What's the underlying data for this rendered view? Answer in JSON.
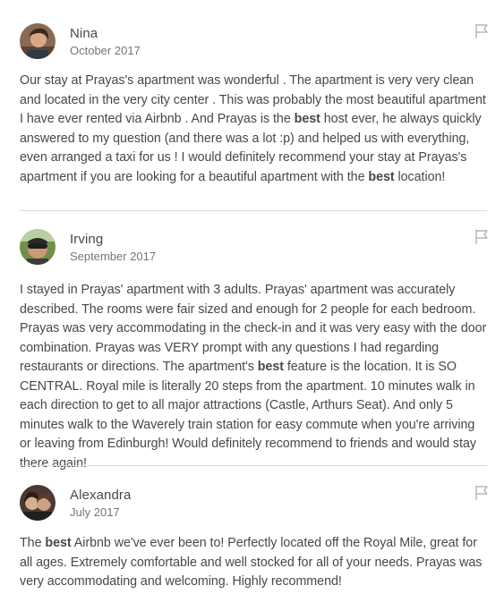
{
  "reviews": [
    {
      "name": "Nina",
      "date": "October 2017",
      "avatar_icon": "avatar-photo-nina",
      "text_parts": [
        {
          "t": "Our stay at Prayas's apartment was wonderful . The apartment is very very clean and located in the very city center . This was probably the most beautiful apartment I have ever rented via Airbnb . And Prayas is the ",
          "b": false
        },
        {
          "t": "best",
          "b": true
        },
        {
          "t": " host ever, he always quickly answered to my question (and there was a lot :p) and helped us with everything, even arranged a taxi for us ! I would definitely recommend your stay at Prayas's apartment if you are looking for a beautiful apartment with the ",
          "b": false
        },
        {
          "t": "best",
          "b": true
        },
        {
          "t": " location!",
          "b": false
        }
      ]
    },
    {
      "name": "Irving",
      "date": "September 2017",
      "avatar_icon": "avatar-photo-irving",
      "text_parts": [
        {
          "t": "I stayed in Prayas' apartment with 3 adults. Prayas' apartment was accurately described. The rooms were fair sized and enough for 2 people for each bedroom. Prayas was very accommodating in the check-in and it was very easy with the door combination. Prayas was VERY prompt with any questions I had regarding restaurants or directions. The apartment's ",
          "b": false
        },
        {
          "t": "best",
          "b": true
        },
        {
          "t": " feature is the location. It is SO CENTRAL. Royal mile is literally 20 steps from the apartment. 10 minutes walk in each direction to get to all major attractions (Castle, Arthurs Seat). And only 5 minutes walk to the Waverely train station for easy commute when you're arriving or leaving from Edinburgh! Would definitely recommend to friends and would stay there again!",
          "b": false
        }
      ]
    },
    {
      "name": "Alexandra",
      "date": "July 2017",
      "avatar_icon": "avatar-photo-alexandra",
      "text_parts": [
        {
          "t": "The ",
          "b": false
        },
        {
          "t": "best",
          "b": true
        },
        {
          "t": " Airbnb we've ever been to! Perfectly located off the Royal Mile, great for all ages. Extremely comfortable and well stocked for all of your needs. Prayas was very accommodating and welcoming. Highly recommend!",
          "b": false
        }
      ]
    }
  ],
  "icons": {
    "flag": "flag-icon"
  },
  "colors": {
    "text": "#484848",
    "muted": "#767676",
    "divider": "#dbdbdb"
  }
}
